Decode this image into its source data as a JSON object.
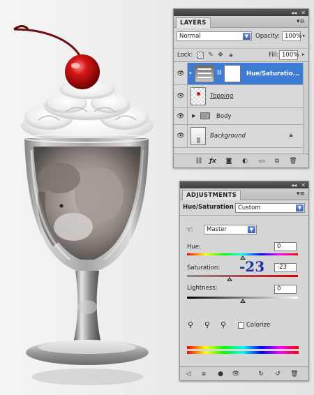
{
  "layers_panel": {
    "tab_label": "LAYERS",
    "blend_mode": "Normal",
    "opacity_label": "Opacity:",
    "opacity_value": "100%",
    "lock_label": "Lock:",
    "fill_label": "Fill:",
    "fill_value": "100%",
    "layers": [
      {
        "name": "Hue/Saturatio...",
        "selected": true
      },
      {
        "name": "Topping"
      },
      {
        "name": "Body"
      },
      {
        "name": "Background"
      }
    ]
  },
  "adjustments_panel": {
    "tab_label": "ADJUSTMENTS",
    "title": "Hue/Saturation",
    "preset": "Custom",
    "channel": "Master",
    "hue": {
      "label": "Hue:",
      "value": "0",
      "level": 0.5
    },
    "saturation": {
      "label": "Saturation:",
      "value": "-23",
      "annotation": "-23",
      "level": 0.385
    },
    "lightness": {
      "label": "Lightness:",
      "value": "0",
      "level": 0.5
    },
    "colorize_label": "Colorize"
  },
  "icons": [
    "eye-icon",
    "link-icon",
    "fx-icon",
    "mask-icon",
    "adjustment-icon",
    "folder-icon",
    "new-layer-icon",
    "trash-icon",
    "lock-icon",
    "eyedropper-icon",
    "hand-adjust-icon"
  ],
  "colors": {
    "selection": "#3d7bd5",
    "annotation": "#1d2fa6",
    "cherry": "#c41414"
  }
}
